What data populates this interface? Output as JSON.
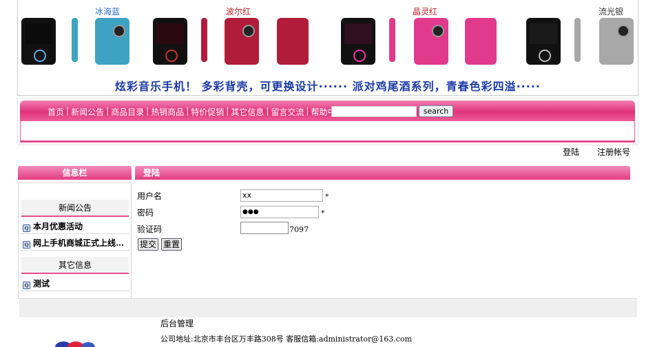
{
  "banner": {
    "phones": [
      {
        "label": "冰海蓝",
        "color": "#3ea3c2",
        "label_color": "#2a6fbf"
      },
      {
        "label": "波尔红",
        "color": "#b11c3a",
        "label_color": "#c0202a"
      },
      {
        "label": "晶灵红",
        "color": "#e13a8c",
        "label_color": "#c0202a"
      },
      {
        "label": "流光银",
        "color": "#a8a8a8",
        "label_color": "#333333"
      }
    ],
    "tagline": "炫彩音乐手机！ 多彩背壳，可更换设计······ 派对鸡尾酒系列，青春色彩四溢·····"
  },
  "nav": {
    "items": [
      "首页",
      "新闻公告",
      "商品目录",
      "热销商品",
      "特价促销",
      "其它信息",
      "留言交流",
      "帮助中心"
    ],
    "search_placeholder": "",
    "search_button": "search"
  },
  "auth": {
    "login": "登陆",
    "register": "注册帐号"
  },
  "sidebar": {
    "header": "信息栏",
    "news_title": "新闻公告",
    "news_items": [
      "本月优惠活动",
      "网上手机商城正式上线…"
    ],
    "other_title": "其它信息",
    "other_items": [
      "测试"
    ]
  },
  "login_form": {
    "header": "登陆",
    "username_label": "用户名",
    "username_value": "xx",
    "password_label": "密码",
    "password_value": "●●●",
    "captcha_label": "验证码",
    "captcha_value": "",
    "captcha_code": "7097",
    "required_mark": "*",
    "submit": "提交",
    "reset": "重置"
  },
  "footer": {
    "admin_link": "后台管理",
    "address": "公司地址:北京市丰台区万丰路308号   客服信箱:administrator@163.com"
  },
  "colors": {
    "accent_pink": "#e23d81",
    "tagline_blue": "#1a3aa6"
  }
}
